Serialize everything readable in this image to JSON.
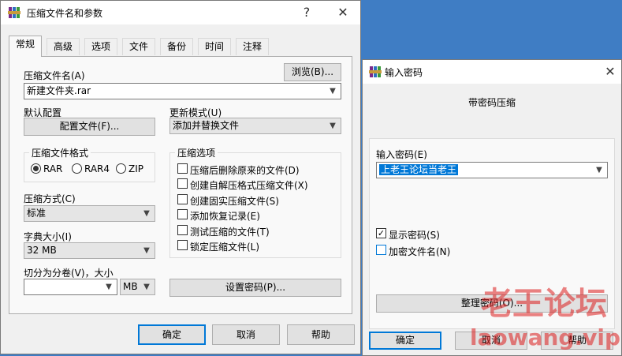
{
  "archive_dialog": {
    "title": "压缩文件名和参数",
    "help_glyph": "?",
    "close_glyph": "✕",
    "tabs": [
      "常规",
      "高级",
      "选项",
      "文件",
      "备份",
      "时间",
      "注释"
    ],
    "archive_name_label": "压缩文件名(A)",
    "browse_button": "浏览(B)...",
    "archive_name_value": "新建文件夹.rar",
    "default_profile_label": "默认配置",
    "profiles_button": "配置文件(F)...",
    "update_mode_label": "更新模式(U)",
    "update_mode_value": "添加并替换文件",
    "format_group_label": "压缩文件格式",
    "formats": [
      "RAR",
      "RAR4",
      "ZIP"
    ],
    "selected_format": "RAR",
    "options_group_label": "压缩选项",
    "options": [
      {
        "label": "压缩后删除原来的文件(D)",
        "checked": false
      },
      {
        "label": "创建自解压格式压缩文件(X)",
        "checked": false
      },
      {
        "label": "创建固实压缩文件(S)",
        "checked": false
      },
      {
        "label": "添加恢复记录(E)",
        "checked": false
      },
      {
        "label": "测试压缩的文件(T)",
        "checked": false
      },
      {
        "label": "锁定压缩文件(L)",
        "checked": false
      }
    ],
    "method_label": "压缩方式(C)",
    "method_value": "标准",
    "dictionary_label": "字典大小(I)",
    "dictionary_value": "32 MB",
    "split_label": "切分为分卷(V)，大小",
    "split_value": "",
    "split_unit": "MB",
    "set_password_button": "设置密码(P)...",
    "ok_button": "确定",
    "cancel_button": "取消",
    "help_button": "帮助"
  },
  "password_dialog": {
    "title": "输入密码",
    "close_glyph": "✕",
    "heading": "带密码压缩",
    "enter_password_label": "输入密码(E)",
    "password_value": "上老王论坛当老王",
    "show_password_label": "显示密码(S)",
    "show_password_checked": true,
    "encrypt_names_label": "加密文件名(N)",
    "encrypt_names_checked": false,
    "organize_button": "整理密码(O)...",
    "ok_button": "确定",
    "cancel_button": "取消",
    "help_button": "帮助"
  },
  "watermark": {
    "brand": "老王论坛",
    "domain": "laowang.vip"
  },
  "colors": {
    "desktop": "#3f7dc4",
    "selection": "#0078d7",
    "watermark": "#dc1e1e"
  }
}
